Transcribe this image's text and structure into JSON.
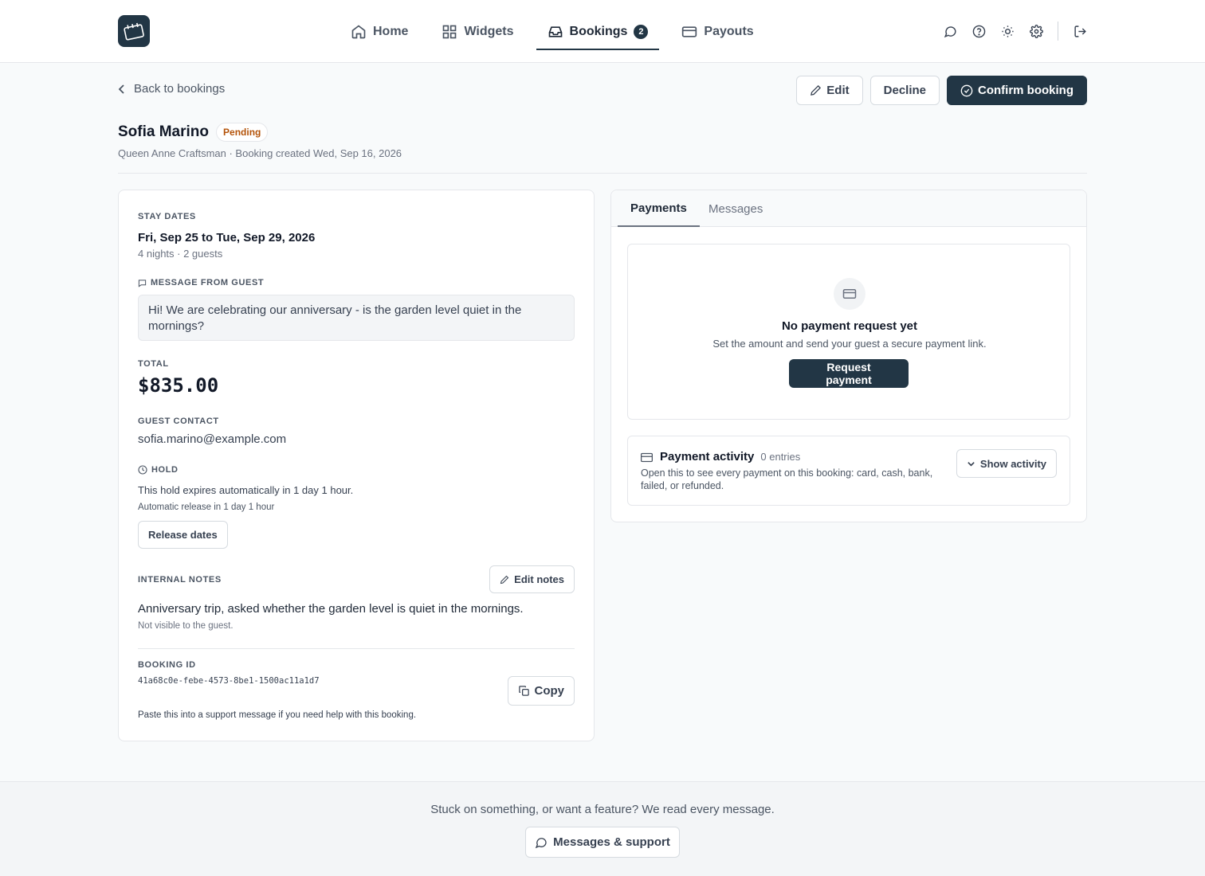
{
  "nav": {
    "items": [
      {
        "label": "Home",
        "icon": "home-icon"
      },
      {
        "label": "Widgets",
        "icon": "grid-icon"
      },
      {
        "label": "Bookings",
        "icon": "inbox-icon",
        "badge": "2",
        "active": true
      },
      {
        "label": "Payouts",
        "icon": "credit-card-icon"
      }
    ]
  },
  "header_icons": [
    "chat-icon",
    "help-icon",
    "sun-icon",
    "gear-icon",
    "logout-icon"
  ],
  "subheader": {
    "back_label": "Back to bookings",
    "edit_label": "Edit",
    "decline_label": "Decline",
    "confirm_label": "Confirm booking"
  },
  "booking": {
    "guest_name": "Sofia Marino",
    "status": "Pending",
    "meta": "Queen Anne Craftsman · Booking created Wed, Sep 16, 2026",
    "stay_dates_label": "Stay dates",
    "stay_dates": "Fri, Sep 25 to Tue, Sep 29, 2026",
    "stay_summary": "4 nights · 2 guests",
    "message_label": "Message from guest",
    "message": "Hi! We are celebrating our anniversary - is the garden level quiet in the mornings?",
    "total_label": "Total",
    "total": "$835.00",
    "contact_label": "Guest contact",
    "contact_email": "sofia.marino@example.com",
    "hold_label": "Hold",
    "hold_text": "This hold expires automatically in 1 day 1 hour.",
    "hold_release": "Automatic release in 1 day 1 hour",
    "release_button": "Release dates",
    "notes_label": "Internal notes",
    "edit_notes_button": "Edit notes",
    "notes": "Anniversary trip, asked whether the garden level is quiet in the mornings.",
    "notes_hint": "Not visible to the guest.",
    "id_label": "Booking ID",
    "id": "41a68c0e-febe-4573-8be1-1500ac11a1d7",
    "copy_button": "Copy",
    "id_hint": "Paste this into a support message if you need help with this booking."
  },
  "payments": {
    "tabs": [
      "Payments",
      "Messages"
    ],
    "active_tab": "Payments",
    "empty_title": "No payment request yet",
    "empty_text": "Set the amount and send your guest a secure payment link.",
    "request_button": "Request payment",
    "activity_title": "Payment activity",
    "activity_count": "0 entries",
    "activity_text": "Open this to see every payment on this booking: card, cash, bank, failed, or refunded.",
    "show_activity_button": "Show activity"
  },
  "footer": {
    "text": "Stuck on something, or want a feature? We read every message.",
    "button": "Messages & support"
  },
  "colors": {
    "brand": "#223645",
    "pending": "#b45309"
  }
}
